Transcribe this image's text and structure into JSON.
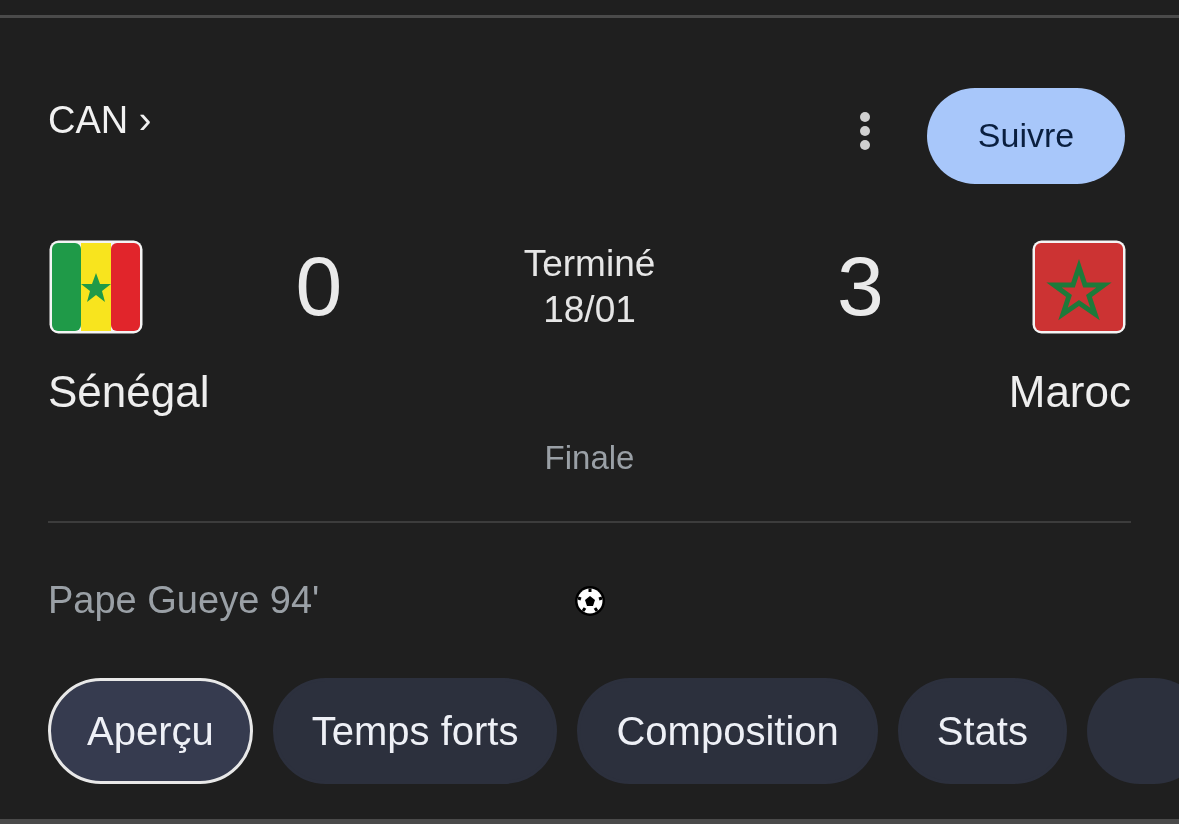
{
  "competition": {
    "label": "CAN ›"
  },
  "follow_button": {
    "label": "Suivre"
  },
  "match": {
    "status": "Terminé",
    "date": "18/01",
    "round": "Finale",
    "home": {
      "name": "Sénégal",
      "score": "0",
      "flag": {
        "kind": "senegal"
      }
    },
    "away": {
      "name": "Maroc",
      "score": "3",
      "flag": {
        "kind": "morocco"
      }
    }
  },
  "scorers": [
    {
      "text": "Pape Gueye 94'",
      "kind": "home"
    }
  ],
  "tabs": [
    {
      "label": "Aperçu",
      "selected": true
    },
    {
      "label": "Temps forts",
      "selected": false
    },
    {
      "label": "Composition",
      "selected": false
    },
    {
      "label": "Stats",
      "selected": false
    }
  ]
}
